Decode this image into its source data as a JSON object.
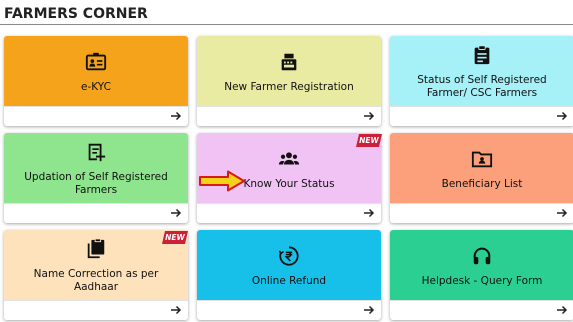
{
  "section": {
    "title": "FARMERS CORNER"
  },
  "colors": {
    "ekyc": "#f5a31a",
    "new_registration": "#e9eba2",
    "status_self_registered": "#a6f0f7",
    "updation": "#8fe58e",
    "know_status": "#f1c3f5",
    "beneficiary": "#fba07a",
    "name_correction": "#fde2bc",
    "online_refund": "#16c0e8",
    "helpdesk": "#2bcf91",
    "badge": "#cc1f3a",
    "pointer_fill": "#f4d21a",
    "pointer_stroke": "#d61a1a"
  },
  "cards": [
    {
      "id": "ekyc",
      "label": "e-KYC",
      "icon": "id-card-icon"
    },
    {
      "id": "new_registration",
      "label": "New Farmer Registration",
      "icon": "register-machine-icon"
    },
    {
      "id": "status_self_registered",
      "label": "Status of Self Registered Farmer/ CSC Farmers",
      "icon": "clipboard-icon"
    },
    {
      "id": "updation",
      "label": "Updation of Self Registered Farmers",
      "icon": "edit-document-icon"
    },
    {
      "id": "know_status",
      "label": "Know Your Status",
      "icon": "group-icon",
      "badge": "NEW"
    },
    {
      "id": "beneficiary",
      "label": "Beneficiary List",
      "icon": "folder-user-icon"
    },
    {
      "id": "name_correction",
      "label": "Name Correction as per Aadhaar",
      "icon": "copy-document-icon",
      "badge": "NEW"
    },
    {
      "id": "online_refund",
      "label": "Online Refund",
      "icon": "rupee-refund-icon"
    },
    {
      "id": "helpdesk",
      "label": "Helpdesk - Query Form",
      "icon": "headset-icon"
    }
  ]
}
